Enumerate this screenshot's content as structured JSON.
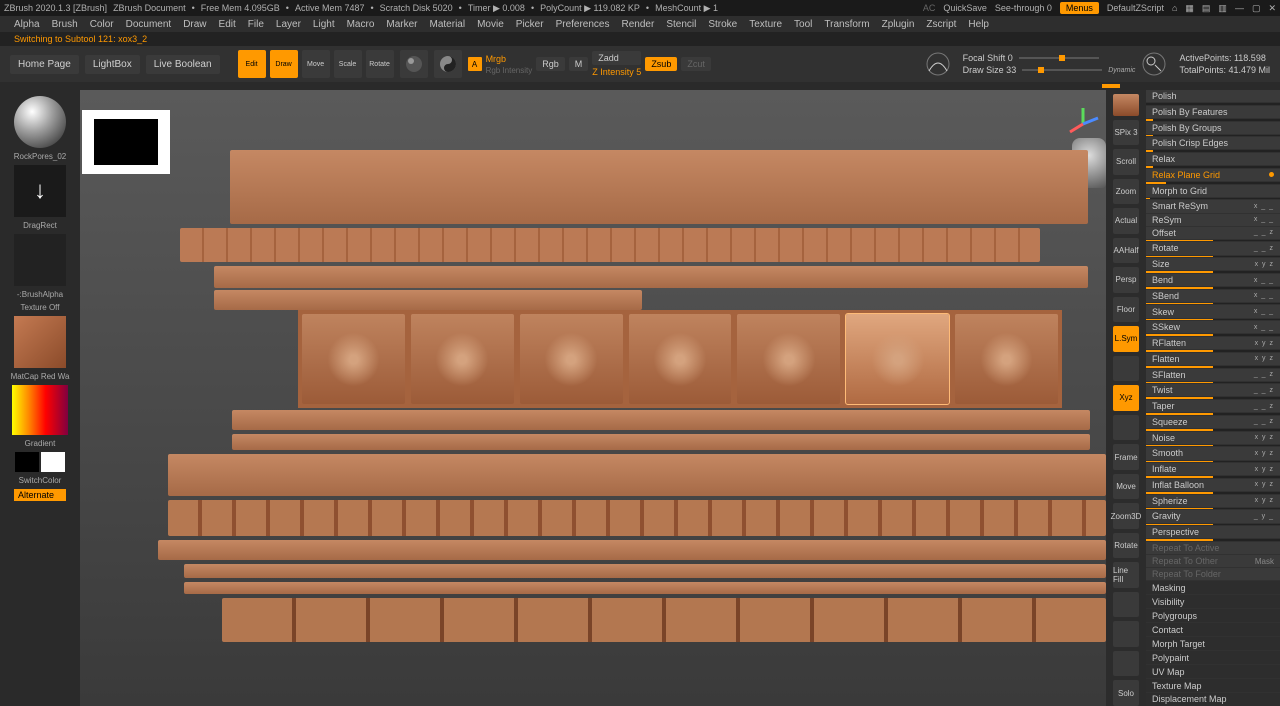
{
  "title_bar": {
    "app": "ZBrush 2020.1.3 [ZBrush]",
    "doc": "ZBrush Document",
    "mem_free": "Free Mem 4.095GB",
    "active_mem": "Active Mem 7487",
    "scratch": "Scratch Disk 5020",
    "timer": "Timer ▶ 0.008",
    "polycount": "PolyCount ▶ 119.082 KP",
    "meshcount": "MeshCount ▶ 1",
    "ac": "AC",
    "quicksave": "QuickSave",
    "seethrough": "See-through  0",
    "menus": "Menus",
    "defaultz": "DefaultZScript"
  },
  "menus": [
    "Alpha",
    "Brush",
    "Color",
    "Document",
    "Draw",
    "Edit",
    "File",
    "Layer",
    "Light",
    "Macro",
    "Marker",
    "Material",
    "Movie",
    "Picker",
    "Preferences",
    "Render",
    "Stencil",
    "Stroke",
    "Texture",
    "Tool",
    "Transform",
    "Zplugin",
    "Zscript",
    "Help"
  ],
  "status": "Switching to Subtool 121:  xox3_2",
  "toolbar": {
    "home": "Home Page",
    "lightbox": "LightBox",
    "live_boolean": "Live Boolean",
    "icons": [
      {
        "name": "edit",
        "label": "Edit",
        "active": true
      },
      {
        "name": "draw",
        "label": "Draw",
        "active": true
      },
      {
        "name": "move",
        "label": "Move",
        "active": false
      },
      {
        "name": "scale",
        "label": "Scale",
        "active": false
      },
      {
        "name": "rotate",
        "label": "Rotate",
        "active": false
      }
    ],
    "a_badge": "A",
    "mrgb": "Mrgb",
    "rgb": "Rgb",
    "rgb_intensity_lbl": "Rgb Intensity",
    "m": "M",
    "zadd": "Zadd",
    "zsub": "Zsub",
    "zcut": "Zcut",
    "z_intensity": "Z Intensity 5",
    "focal_shift": "Focal Shift 0",
    "draw_size": "Draw Size 33",
    "dynamic": "Dynamic",
    "active_points": "ActivePoints: 118.598",
    "total_points": "TotalPoints: 41.479 Mil"
  },
  "left_panel": {
    "material": "RockPores_02",
    "stroke": "DragRect",
    "brush_alpha": "-:BrushAlpha",
    "texture_off": "Texture Off",
    "matcap": "MatCap Red Wa",
    "gradient": "Gradient",
    "switch": "SwitchColor",
    "alternate": "Alternate"
  },
  "right_tools": [
    {
      "name": "thumb3d",
      "label": "",
      "type": "swatch"
    },
    {
      "name": "spix",
      "label": "SPix 3",
      "type": "text"
    },
    {
      "name": "scroll",
      "label": "Scroll"
    },
    {
      "name": "zoom",
      "label": "Zoom"
    },
    {
      "name": "actual",
      "label": "Actual"
    },
    {
      "name": "aahalf",
      "label": "AAHalf"
    },
    {
      "name": "persp",
      "label": "Persp"
    },
    {
      "name": "floor",
      "label": "Floor"
    },
    {
      "name": "local-sym",
      "label": "L.Sym",
      "orange": true
    },
    {
      "name": "lock",
      "label": ""
    },
    {
      "name": "xyz",
      "label": "Xyz",
      "orange": true
    },
    {
      "name": "center",
      "label": ""
    },
    {
      "name": "frame",
      "label": "Frame"
    },
    {
      "name": "move2",
      "label": "Move"
    },
    {
      "name": "zoom3d",
      "label": "Zoom3D"
    },
    {
      "name": "rotate2",
      "label": "Rotate"
    },
    {
      "name": "line-fill",
      "label": "Line Fill"
    },
    {
      "name": "polyf",
      "label": ""
    },
    {
      "name": "trans",
      "label": ""
    },
    {
      "name": "ghost",
      "label": ""
    },
    {
      "name": "solo",
      "label": "Solo"
    }
  ],
  "deformation": {
    "items": [
      {
        "label": "Polish",
        "slider": 0
      },
      {
        "label": "Polish By Features",
        "slider": 5
      },
      {
        "label": "Polish By Groups",
        "slider": 5
      },
      {
        "label": "Polish Crisp Edges",
        "slider": 5
      },
      {
        "label": "Relax",
        "slider": 5
      },
      {
        "label": "Relax Plane Grid",
        "slider": 15,
        "dot": true,
        "orange": true
      },
      {
        "label": "Morph to Grid",
        "slider": 3
      },
      {
        "label": "Smart ReSym",
        "xyz": "x _ _"
      },
      {
        "label": "ReSym",
        "xyz": "x _ _"
      },
      {
        "label": "Offset",
        "xyz": "_ _ z",
        "slider": 50
      },
      {
        "label": "Rotate",
        "xyz": "_ _ z",
        "slider": 50
      },
      {
        "label": "Size",
        "xyz": "x y z",
        "slider": 50
      },
      {
        "label": "Bend",
        "xyz": "x _ _",
        "slider": 50
      },
      {
        "label": "SBend",
        "xyz": "x _ _",
        "slider": 50
      },
      {
        "label": "Skew",
        "xyz": "x _ _",
        "slider": 50
      },
      {
        "label": "SSkew",
        "xyz": "x _ _",
        "slider": 50
      },
      {
        "label": "RFlatten",
        "xyz": "x y z",
        "slider": 50
      },
      {
        "label": "Flatten",
        "xyz": "x y z",
        "slider": 50
      },
      {
        "label": "SFlatten",
        "xyz": "_ _ z",
        "slider": 50
      },
      {
        "label": "Twist",
        "xyz": "_ _ z",
        "slider": 50
      },
      {
        "label": "Taper",
        "xyz": "_ _ z",
        "slider": 50
      },
      {
        "label": "Squeeze",
        "xyz": "_ _ z",
        "slider": 50
      },
      {
        "label": "Noise",
        "xyz": "x y z",
        "slider": 50
      },
      {
        "label": "Smooth",
        "xyz": "x y z",
        "slider": 50
      },
      {
        "label": "Inflate",
        "xyz": "x y z",
        "slider": 50
      },
      {
        "label": "Inflat Balloon",
        "xyz": "x y z",
        "slider": 50
      },
      {
        "label": "Spherize",
        "xyz": "x y z",
        "slider": 50
      },
      {
        "label": "Gravity",
        "xyz": "_ y _",
        "slider": 50
      },
      {
        "label": "Perspective",
        "slider": 50
      }
    ],
    "repeat_active": "Repeat To Active",
    "repeat_other": "Repeat To Other",
    "repeat_mask_tag": "Mask",
    "repeat_folder": "Repeat To Folder",
    "sections": [
      "Masking",
      "Visibility",
      "Polygroups",
      "Contact",
      "Morph Target",
      "Polypaint",
      "UV Map",
      "Texture Map",
      "Displacement Map"
    ]
  }
}
